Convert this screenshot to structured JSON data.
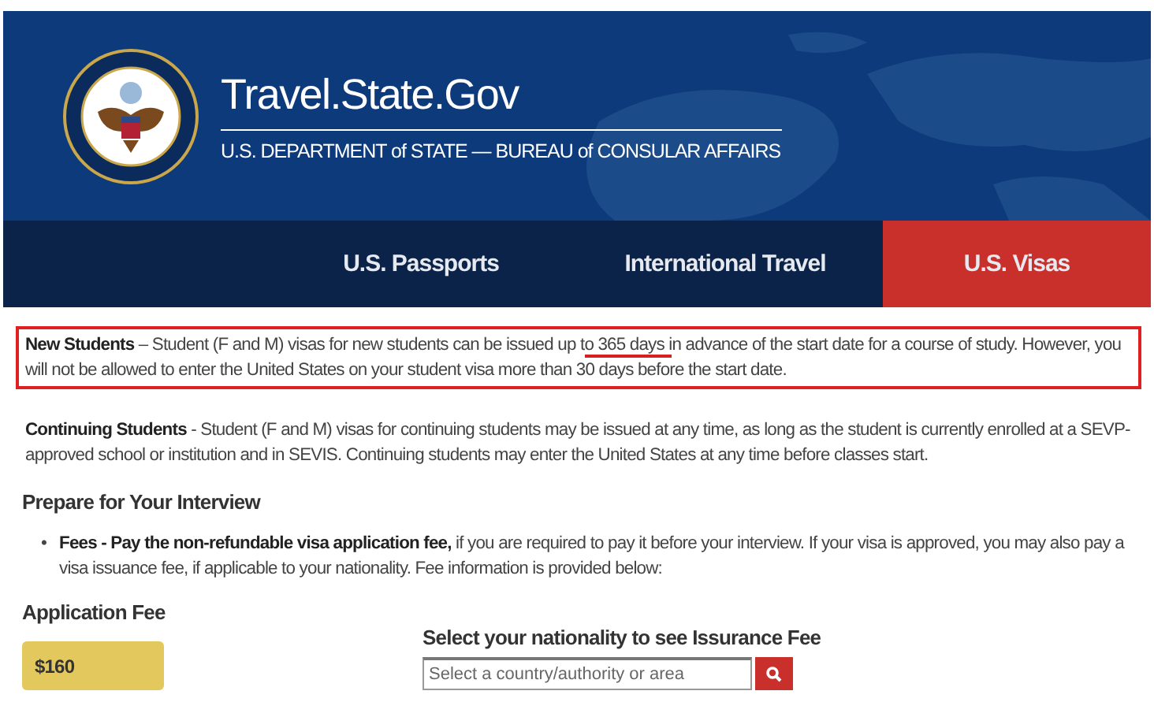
{
  "header": {
    "title": "Travel.State.Gov",
    "subtitle": "U.S. DEPARTMENT of STATE — BUREAU of CONSULAR AFFAIRS"
  },
  "nav": [
    {
      "label": "U.S. Passports",
      "selected": false
    },
    {
      "label": "International Travel",
      "selected": false
    },
    {
      "label": "U.S. Visas",
      "selected": true
    }
  ],
  "new_students": {
    "highlighted": true,
    "lead": "New Students",
    "before": " – Student (F and M) visas for new students can be issued up t",
    "marked": "o 365 days i",
    "after": "n advance of the start date for a course of study.  However, you will not be allowed to enter the United States on your student visa more than 30 days before the start date."
  },
  "continuing_students": {
    "lead": "Continuing Students",
    "body": " - Student (F and M) visas for continuing students may be issued at any time, as long as the student is currently enrolled at a SEVP-approved school or institution and in SEVIS.  Continuing students may enter the United States at any time before classes start."
  },
  "interview_heading": "Prepare for Your Interview",
  "bullets": [
    {
      "marker": "•",
      "text": "**Fees - Pay the non-refundable visa application fee,** if you are required to pay it before your interview. If your visa is approved, you may also pay a visa issuance fee, if applicable to your nationality. Fee information is provided below:"
    }
  ],
  "application_fee": {
    "heading": "Application Fee",
    "amount": "$160"
  },
  "issuance": {
    "heading": "Select your nationality to see Issurance Fee",
    "placeholder": "Select a country/authority or area"
  }
}
